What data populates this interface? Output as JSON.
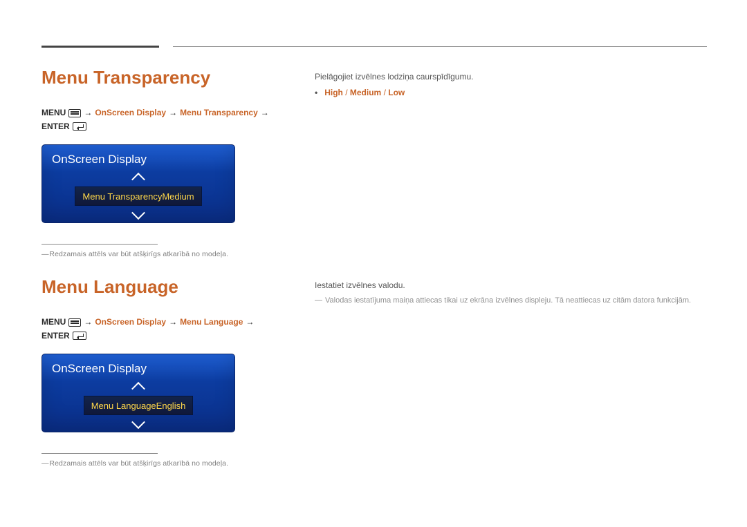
{
  "section1": {
    "heading": "Menu Transparency",
    "path": {
      "menu": "MENU",
      "arrow": "→",
      "osd": "OnScreen Display",
      "item": "Menu Transparency",
      "enter": "ENTER"
    },
    "panel": {
      "title": "OnScreen Display",
      "row": {
        "label": "Menu Transparency",
        "value": "Medium"
      }
    },
    "footnote": "Redzamais attēls var būt atšķirīgs atkarībā no modeļa."
  },
  "section2": {
    "heading": "Menu Language",
    "path": {
      "menu": "MENU",
      "arrow": "→",
      "osd": "OnScreen Display",
      "item": "Menu Language",
      "enter": "ENTER"
    },
    "panel": {
      "title": "OnScreen Display",
      "row": {
        "label": "Menu Language",
        "value": "English"
      }
    },
    "footnote": "Redzamais attēls var būt atšķirīgs atkarībā no modeļa."
  },
  "right1": {
    "desc": "Pielāgojiet izvēlnes lodziņa caurspīdīgumu.",
    "options": {
      "a": "High",
      "b": "Medium",
      "c": "Low",
      "sep": "/"
    }
  },
  "right2": {
    "desc": "Iestatiet izvēlnes valodu.",
    "note": "Valodas iestatījuma maiņa attiecas tikai uz ekrāna izvēlnes displeju. Tā neattiecas uz citām datora funkcijām."
  }
}
